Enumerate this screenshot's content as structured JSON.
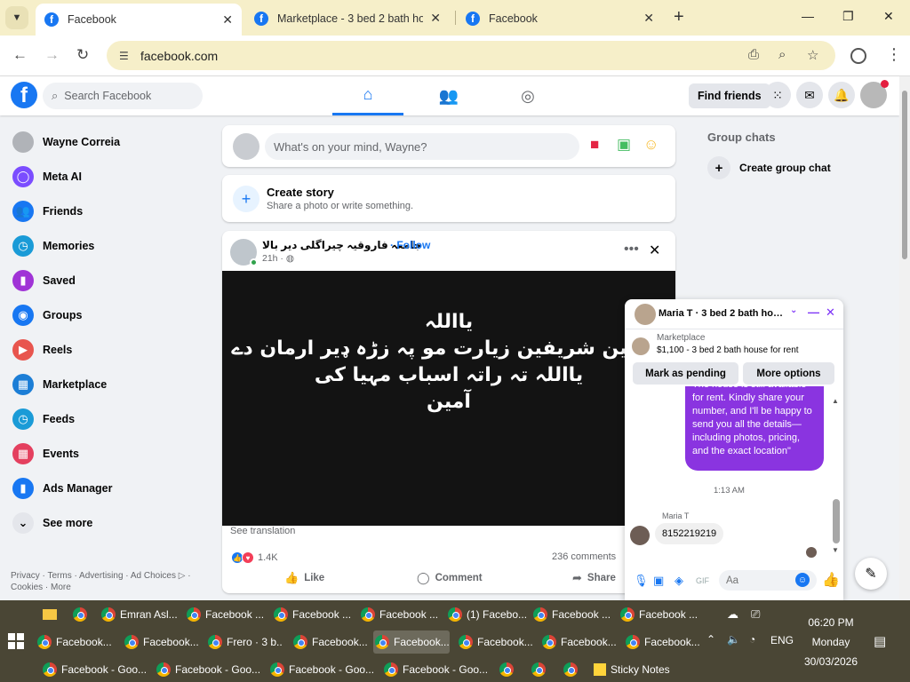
{
  "browser": {
    "tabs": [
      {
        "label": "Facebook",
        "active": true
      },
      {
        "label": "Marketplace - 3 bed 2 bath hou",
        "active": false
      },
      {
        "label": "Facebook",
        "active": false
      }
    ],
    "url": "facebook.com"
  },
  "fb": {
    "search_placeholder": "Search Facebook",
    "find_friends": "Find friends",
    "sidebar": [
      {
        "label": "Wayne Correia",
        "icon": "avatar",
        "color": "#b0b3b8"
      },
      {
        "label": "Meta AI",
        "icon": "meta-ai-icon",
        "color": "#7b4dff"
      },
      {
        "label": "Friends",
        "icon": "friends-icon",
        "color": "#1877f2"
      },
      {
        "label": "Memories",
        "icon": "clock-icon",
        "color": "#1a9bd7"
      },
      {
        "label": "Saved",
        "icon": "bookmark-icon",
        "color": "#a033d6"
      },
      {
        "label": "Groups",
        "icon": "groups-icon",
        "color": "#1877f2"
      },
      {
        "label": "Reels",
        "icon": "reels-icon",
        "color": "#e8554e"
      },
      {
        "label": "Marketplace",
        "icon": "shop-icon",
        "color": "#1c7ed6"
      },
      {
        "label": "Feeds",
        "icon": "feeds-icon",
        "color": "#1a9bd7"
      },
      {
        "label": "Events",
        "icon": "calendar-icon",
        "color": "#e4405f"
      },
      {
        "label": "Ads Manager",
        "icon": "chart-icon",
        "color": "#1877f2"
      },
      {
        "label": "See more",
        "icon": "chevron-down-icon",
        "color": "#e4e6eb"
      }
    ],
    "footer": "Privacy · Terms · Advertising · Ad Choices ▷ · Cookies · More",
    "composer_placeholder": "What's on your mind, Wayne?",
    "story": {
      "title": "Create story",
      "subtitle": "Share a photo or write something."
    },
    "post": {
      "author": "جامعہ فاروقیہ چیراگلی دیر بالا",
      "follow": "· Follow",
      "time": "21h · ◍",
      "lines": [
        "یااللہ",
        "حرمین شریفین زیارت مو پہ زڑہ ډیر ارمان دے",
        "یااللہ تہ راتہ اسباب مہیا کی",
        "آمین"
      ],
      "see_translation": "See translation",
      "reactions": "1.4K",
      "comments": "236 comments",
      "actions": [
        "Like",
        "Comment",
        "Share"
      ]
    },
    "right": {
      "title": "Group chats",
      "create": "Create group chat"
    },
    "chat": {
      "name": "Maria T · 3 bed 2 bath house for rent",
      "listing_source": "Marketplace",
      "listing": "$1,100 - 3 bed 2 bath house for rent",
      "buttons": [
        "Mark as pending",
        "More options"
      ],
      "outgoing": "The house is still available for rent. Kindly share your number, and I'll be happy to send you all the details—including photos, pricing, and the exact location\"",
      "time": "1:13 AM",
      "sender": "Maria T",
      "incoming": "8152219219",
      "input_placeholder": "Aa"
    },
    "accent": "#1877f2",
    "bubble_color": "#8a34e0"
  },
  "taskbar": {
    "row1": [
      "Emran Asl...",
      "Facebook ...",
      "Facebook ...",
      "Facebook ...",
      "(1) Facebo...",
      "Facebook ...",
      "Facebook ..."
    ],
    "row2": [
      "Facebook...",
      "Facebook...",
      "Frero · 3 b...",
      "Facebook...",
      "Facebook...",
      "Facebook...",
      "Facebook...",
      "Facebook..."
    ],
    "row3": [
      "Facebook - Goo...",
      "Facebook - Goo...",
      "Facebook - Goo...",
      "Facebook - Goo...",
      "Sticky Notes"
    ],
    "lang": "ENG",
    "time": "06:20 PM",
    "day": "Monday",
    "date": "30/03/2026"
  }
}
